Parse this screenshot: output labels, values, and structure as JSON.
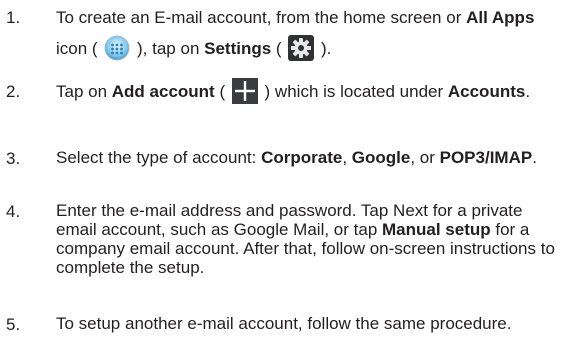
{
  "steps": [
    {
      "num": "1.",
      "t1": "To create an E-mail account, from the home screen or ",
      "b1": "All Apps",
      "t2": " icon ( ",
      "t3": " ), tap on ",
      "b2": "Settings",
      "t4": " ( ",
      "t5": " )."
    },
    {
      "num": "2.",
      "t1": "Tap on ",
      "b1": "Add account",
      "t2": " ( ",
      "t3": " ) which is located under ",
      "b2": "Accounts",
      "t4": "."
    },
    {
      "num": "3.",
      "t1": "Select the type of account: ",
      "b1": "Corporate",
      "t2": ", ",
      "b2": "Google",
      "t3": ", or ",
      "b3": "POP3/IMAP",
      "t4": "."
    },
    {
      "num": "4.",
      "t1": "Enter the e-mail address and password. Tap Next for a private email account, such as Google Mail, or tap ",
      "b1": "Manual setup",
      "t2": " for a company email account. After that, follow on-screen instructions to complete the setup."
    },
    {
      "num": "5.",
      "t1": "To setup another e-mail account, follow the same procedure."
    }
  ],
  "icons": {
    "all_apps": "all-apps-icon",
    "settings": "settings-gear-icon",
    "add_account": "plus-icon"
  }
}
